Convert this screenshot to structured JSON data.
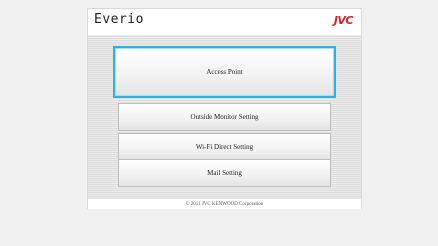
{
  "header": {
    "app_title": "Everio",
    "brand": "JVC"
  },
  "menu": {
    "items": [
      {
        "label": "Access Point",
        "selected": true
      },
      {
        "label": "Outside Monitor Setting",
        "selected": false
      },
      {
        "label": "Wi-Fi Direct Setting",
        "selected": false
      },
      {
        "label": "Mail Setting",
        "selected": false
      }
    ]
  },
  "footer": {
    "copyright": "© 2011 JVC KENWOOD Corporation"
  },
  "colors": {
    "brand_red": "#d2232a",
    "selection_blue": "#2eb0e3"
  }
}
